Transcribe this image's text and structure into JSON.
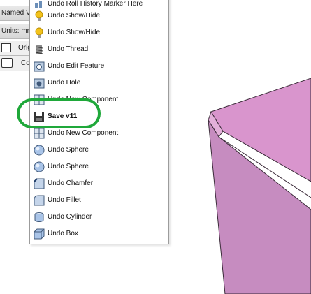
{
  "browser": {
    "rows": [
      {
        "label": "Named V"
      },
      {
        "label": "Units: mm"
      },
      {
        "label": "Orig"
      },
      {
        "label": "Co"
      }
    ]
  },
  "menu": {
    "items": [
      {
        "label": "Undo Roll History Marker Here",
        "icon": "history-marker-icon"
      },
      {
        "label": "Undo Show/Hide",
        "icon": "lightbulb-icon"
      },
      {
        "label": "Undo Show/Hide",
        "icon": "lightbulb-icon"
      },
      {
        "label": "Undo Thread",
        "icon": "thread-icon"
      },
      {
        "label": "Undo Edit Feature",
        "icon": "edit-feature-icon"
      },
      {
        "label": "Undo Hole",
        "icon": "hole-icon"
      },
      {
        "label": "Undo New Component",
        "icon": "new-component-icon"
      },
      {
        "label": "Save v11",
        "icon": "save-icon"
      },
      {
        "label": "Undo New Component",
        "icon": "new-component-icon"
      },
      {
        "label": "Undo Sphere",
        "icon": "sphere-icon"
      },
      {
        "label": "Undo Sphere",
        "icon": "sphere-icon"
      },
      {
        "label": "Undo Chamfer",
        "icon": "chamfer-icon"
      },
      {
        "label": "Undo Fillet",
        "icon": "fillet-icon"
      },
      {
        "label": "Undo Cylinder",
        "icon": "cylinder-icon"
      },
      {
        "label": "Undo Box",
        "icon": "box-icon"
      }
    ]
  },
  "colors": {
    "highlight": "#1fa83a",
    "body_fill": "#d68fca",
    "body_side": "#c58abf",
    "body_edge": "#3a2a38"
  }
}
